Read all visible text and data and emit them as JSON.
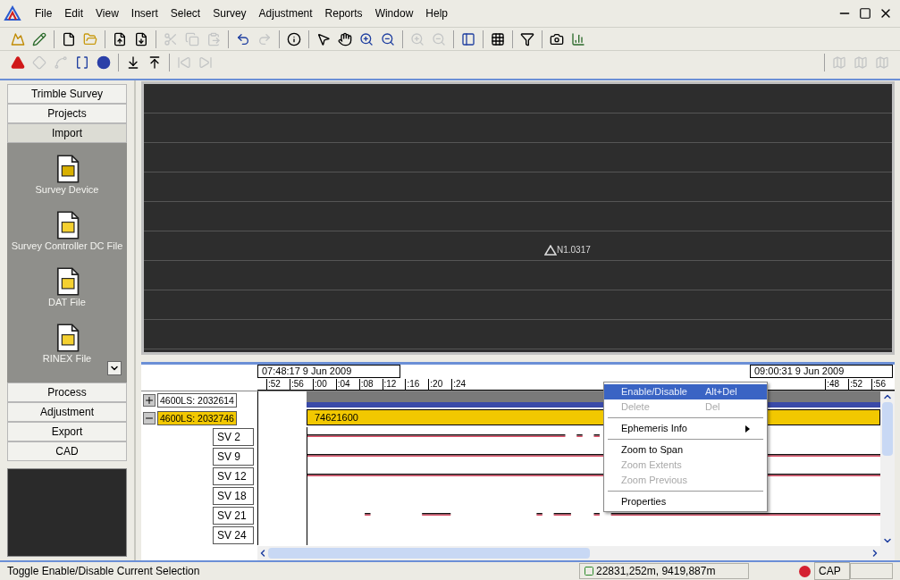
{
  "menu_bar": [
    "File",
    "Edit",
    "View",
    "Insert",
    "Select",
    "Survey",
    "Adjustment",
    "Reports",
    "Window",
    "Help"
  ],
  "toolbar_main": [
    {
      "kind": "button",
      "disabled": false
    },
    {
      "kind": "button",
      "disabled": false
    },
    {
      "kind": "separator"
    },
    {
      "kind": "button",
      "disabled": false
    },
    {
      "kind": "button",
      "disabled": false
    },
    {
      "kind": "separator"
    },
    {
      "kind": "button",
      "disabled": false
    },
    {
      "kind": "button",
      "disabled": false
    },
    {
      "kind": "separator"
    },
    {
      "kind": "button",
      "disabled": true
    },
    {
      "kind": "button",
      "disabled": true
    },
    {
      "kind": "button",
      "disabled": true
    },
    {
      "kind": "separator"
    },
    {
      "kind": "button",
      "disabled": false
    },
    {
      "kind": "button",
      "disabled": true
    },
    {
      "kind": "separator"
    },
    {
      "kind": "button",
      "disabled": false
    },
    {
      "kind": "separator"
    },
    {
      "kind": "button",
      "disabled": false
    },
    {
      "kind": "button",
      "disabled": false
    },
    {
      "kind": "button",
      "disabled": false
    },
    {
      "kind": "button",
      "disabled": false
    },
    {
      "kind": "separator"
    },
    {
      "kind": "button",
      "disabled": true
    },
    {
      "kind": "button",
      "disabled": true
    },
    {
      "kind": "separator"
    },
    {
      "kind": "button",
      "disabled": false
    },
    {
      "kind": "separator"
    },
    {
      "kind": "button",
      "disabled": false
    },
    {
      "kind": "separator"
    },
    {
      "kind": "button",
      "disabled": false
    },
    {
      "kind": "separator"
    },
    {
      "kind": "button",
      "disabled": false
    },
    {
      "kind": "button",
      "disabled": false
    }
  ],
  "toolbar_secondary": [
    {
      "kind": "button",
      "disabled": false
    },
    {
      "kind": "button",
      "disabled": true
    },
    {
      "kind": "button",
      "disabled": true
    },
    {
      "kind": "button",
      "disabled": false
    },
    {
      "kind": "button",
      "disabled": false
    },
    {
      "kind": "separator"
    },
    {
      "kind": "button",
      "disabled": false
    },
    {
      "kind": "button",
      "disabled": false
    },
    {
      "kind": "separator"
    },
    {
      "kind": "button",
      "disabled": true
    },
    {
      "kind": "button",
      "disabled": true
    }
  ],
  "toolbar_right": [
    {
      "kind": "button",
      "disabled": true
    },
    {
      "kind": "button",
      "disabled": true
    },
    {
      "kind": "button",
      "disabled": true
    }
  ],
  "sidebar": {
    "sections_top": [
      {
        "label": "Trimble Survey",
        "selected": false
      },
      {
        "label": "Projects",
        "selected": false
      },
      {
        "label": "Import",
        "selected": true
      }
    ],
    "import_items": [
      "Survey Device",
      "Survey Controller DC File",
      "DAT File",
      "RINEX File"
    ],
    "sections_bottom": [
      {
        "label": "Process",
        "selected": false
      },
      {
        "label": "Adjustment",
        "selected": false
      },
      {
        "label": "Export",
        "selected": false
      },
      {
        "label": "CAD",
        "selected": false
      }
    ]
  },
  "map_view": {
    "point_label": "N1.0317"
  },
  "timeline": {
    "start_time": "07:48:17 9 Jun 2009",
    "end_time": "09:00:31 9 Jun 2009",
    "ticks_left": [
      ":52",
      ":56",
      ":00",
      ":04",
      ":08",
      ":12",
      ":16",
      ":20",
      ":24"
    ],
    "ticks_right": [
      ":48",
      ":52",
      ":56"
    ],
    "receivers": [
      {
        "label": "4600LS: 2032614",
        "expanded": false,
        "selected": false
      },
      {
        "label": "4600LS: 2032746",
        "expanded": true,
        "selected": true,
        "bar_label": "74621600",
        "children": [
          "SV 2",
          "SV 9",
          "SV 12",
          "SV 18",
          "SV 21",
          "SV 24"
        ]
      }
    ]
  },
  "context_menu": [
    {
      "kind": "item",
      "label": "Enable/Disable",
      "shortcut": "Alt+Del",
      "disabled": false,
      "selected": true
    },
    {
      "kind": "item",
      "label": "Delete",
      "shortcut": "Del",
      "disabled": true,
      "selected": false
    },
    {
      "kind": "separator"
    },
    {
      "kind": "submenu",
      "label": "Ephemeris Info",
      "disabled": false,
      "selected": false
    },
    {
      "kind": "separator"
    },
    {
      "kind": "item",
      "label": "Zoom to Span",
      "disabled": false,
      "selected": false
    },
    {
      "kind": "item",
      "label": "Zoom Extents",
      "disabled": true,
      "selected": false
    },
    {
      "kind": "item",
      "label": "Zoom Previous",
      "disabled": true,
      "selected": false
    },
    {
      "kind": "separator"
    },
    {
      "kind": "item",
      "label": "Properties",
      "disabled": false,
      "selected": false
    }
  ],
  "status_bar": {
    "message": "Toggle Enable/Disable Current Selection",
    "coordinates": "22831,252m, 9419,887m",
    "caps": "CAP"
  }
}
